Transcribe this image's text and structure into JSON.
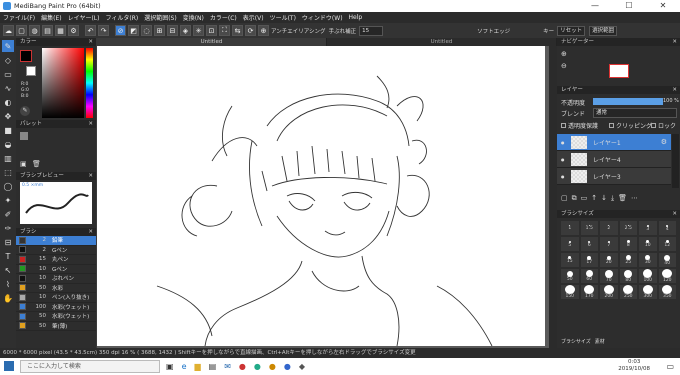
{
  "title": "MediBang Paint Pro (64bit)",
  "window_controls": [
    "—",
    "☐",
    "✕"
  ],
  "menu": [
    "ファイル(F)",
    "編集(E)",
    "レイヤー(L)",
    "フィルタ(R)",
    "選択範囲(S)",
    "変換(N)",
    "カラー(C)",
    "表示(V)",
    "ツール(T)",
    "ウィンドウ(W)",
    "Help"
  ],
  "toolbar": {
    "antialias_label": "アンチエイリアシング",
    "correction_label": "手ぶれ補正",
    "correction_value": "15",
    "soft_edge_label": "ソフトエッジ",
    "key_label": "キー",
    "reset_label": "リセット",
    "select_draw_label": "選択範囲"
  },
  "tabs": [
    "Untitled",
    "Untitled"
  ],
  "color_panel": {
    "title": "カラー",
    "values": [
      "R:0",
      "G:0",
      "B:0"
    ],
    "primary": "#000000",
    "secondary": "#ffffff"
  },
  "palette_panel": {
    "title": "パレット"
  },
  "brush_preview_panel": {
    "title": "ブラシプレビュー",
    "size_text": "0.5 ×mm"
  },
  "brush_panel": {
    "title": "ブラシ",
    "items": [
      {
        "size": "2",
        "name": "鉛筆",
        "color": "#333333"
      },
      {
        "size": "2",
        "name": "Gペン",
        "color": "#111111"
      },
      {
        "size": "15",
        "name": "丸ペン",
        "color": "#cc2222"
      },
      {
        "size": "10",
        "name": "Gペン",
        "color": "#229922"
      },
      {
        "size": "10",
        "name": "ぶれペン",
        "color": "#111111"
      },
      {
        "size": "50",
        "name": "水彩",
        "color": "#e0a020"
      },
      {
        "size": "10",
        "name": "ペン(入り抜き)",
        "color": "#aaaaaa"
      },
      {
        "size": "100",
        "name": "水彩(ウェット)",
        "color": "#3d7fd3"
      },
      {
        "size": "50",
        "name": "水彩(ウェット)",
        "color": "#3d7fd3"
      },
      {
        "size": "50",
        "name": "筆(薄)",
        "color": "#e0a020"
      }
    ]
  },
  "navigator_panel": {
    "title": "ナビゲーター"
  },
  "layer_panel": {
    "title": "レイヤー",
    "opacity_label": "不透明度",
    "opacity_value": "100 %",
    "opacity_fraction": 1.0,
    "blend_label": "ブレンド",
    "blend_value": "通常",
    "protect_label": "透明度保護",
    "clip_label": "クリッピング",
    "lock_label": "ロック",
    "layers": [
      {
        "name": "レイヤー1",
        "selected": true
      },
      {
        "name": "レイヤー4",
        "selected": false
      },
      {
        "name": "レイヤー3",
        "selected": false
      }
    ]
  },
  "brush_size_panel": {
    "title": "ブラシサイズ",
    "sizes": [
      "1",
      "1.5",
      "2",
      "2.5",
      "3",
      "4",
      "5",
      "6",
      "7",
      "8",
      "10",
      "12",
      "15",
      "17",
      "20",
      "25",
      "30",
      "40",
      "50",
      "60",
      "70",
      "80",
      "100",
      "120",
      "150",
      "170",
      "200",
      "250",
      "300",
      "350"
    ],
    "footer_tabs": [
      "ブラシサイズ",
      "素材"
    ]
  },
  "status_bar": "6000 * 6000 pixel  (43.5 * 43.5cm)  350 dpi  16 %  ( 3688, 1432 )  Shiftキーを押しながらで直線描画、Ctrl+Altキーを押しながら左右ドラッグでブラシサイズ変更",
  "taskbar": {
    "search_placeholder": "ここに入力して検索",
    "time": "0:03",
    "date": "2019/10/08"
  }
}
